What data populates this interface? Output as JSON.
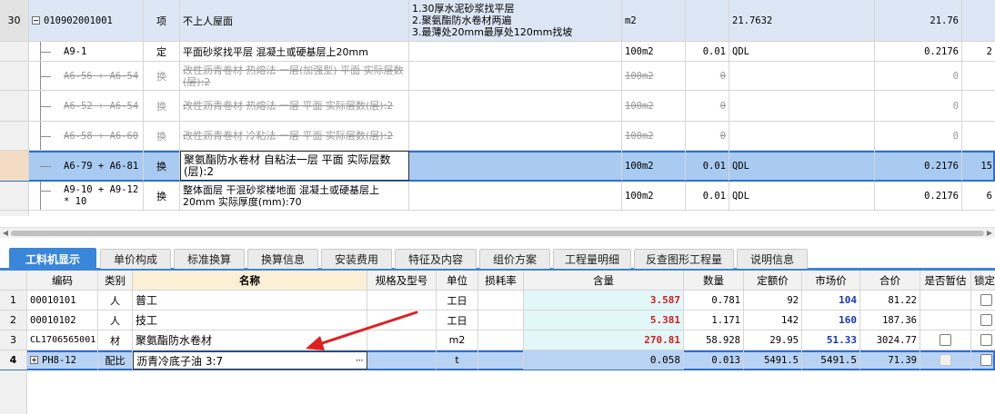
{
  "top_rows": [
    {
      "idx": "30",
      "code": "010902001001",
      "type": "项",
      "name": "不上人屋面",
      "features": [
        "1.30厚水泥砂浆找平层",
        "2.聚氨酯防水卷材两遍",
        "3.最薄处20mm最厚处120mm找坡"
      ],
      "unit": "m2",
      "qty": "",
      "expr": "21.7632",
      "qty2": "21.76",
      "rest": ""
    },
    {
      "idx": "",
      "code": "A9-1",
      "type": "定",
      "name": "平面砂浆找平层 混凝土或硬基层上20mm",
      "unit": "100m2",
      "qty": "0.01",
      "expr": "QDL",
      "qty2": "0.2176",
      "rest": "2"
    },
    {
      "idx": "",
      "code": "A6-56 + A6-54",
      "type": "换",
      "name": "改性沥青卷材 热熔法 一层(加强型) 平面 实际层数(层):2",
      "unit": "100m2",
      "qty": "0",
      "expr": "",
      "qty2": "0",
      "rest": ""
    },
    {
      "idx": "",
      "code": "A6-52 + A6-54",
      "type": "换",
      "name": "改性沥青卷材 热熔法 一层 平面 实际层数(层):2",
      "unit": "100m2",
      "qty": "0",
      "expr": "",
      "qty2": "0",
      "rest": ""
    },
    {
      "idx": "",
      "code": "A6-58 + A6-60",
      "type": "换",
      "name": "改性沥青卷材 冷粘法 一层 平面 实际层数(层):2",
      "unit": "100m2",
      "qty": "0",
      "expr": "",
      "qty2": "0",
      "rest": ""
    },
    {
      "idx": "",
      "code": "A6-79 + A6-81",
      "type": "换",
      "name": "聚氨酯防水卷材 自粘法一层 平面  实际层数(层):2",
      "unit": "100m2",
      "qty": "0.01",
      "expr": "QDL",
      "qty2": "0.2176",
      "rest": "15"
    },
    {
      "idx": "",
      "code": "A9-10 + A9-12 * 10",
      "type": "换",
      "name": "整体面层 干混砂浆楼地面 混凝土或硬基层上20mm  实际厚度(mm):70",
      "unit": "100m2",
      "qty": "0.01",
      "expr": "QDL",
      "qty2": "0.2176",
      "rest": "6"
    }
  ],
  "tabs": [
    "工料机显示",
    "单价构成",
    "标准换算",
    "换算信息",
    "安装费用",
    "特征及内容",
    "组价方案",
    "工程量明细",
    "反查图形工程量",
    "说明信息"
  ],
  "bottom_headers": {
    "idx": "",
    "code": "编码",
    "cat": "类别",
    "name": "名称",
    "spec": "规格及型号",
    "unit": "单位",
    "loss": "损耗率",
    "content": "含量",
    "count": "数量",
    "quota": "定额价",
    "market": "市场价",
    "total": "合价",
    "est": "是否暂估",
    "lock": "锁定"
  },
  "bottom_rows": [
    {
      "idx": "1",
      "code": "00010101",
      "cat": "人",
      "name": "普工",
      "unit": "工日",
      "content": "3.587",
      "count": "0.781",
      "quota": "92",
      "market": "104",
      "total": "81.22"
    },
    {
      "idx": "2",
      "code": "00010102",
      "cat": "人",
      "name": "技工",
      "unit": "工日",
      "content": "5.381",
      "count": "1.171",
      "quota": "142",
      "market": "160",
      "total": "187.36"
    },
    {
      "idx": "3",
      "code": "CL1706565001",
      "cat": "材",
      "name": "聚氨酯防水卷材",
      "unit": "m2",
      "content": "270.81",
      "count": "58.928",
      "quota": "29.95",
      "market": "51.33",
      "total": "3024.77"
    },
    {
      "idx": "4",
      "code": "PH8-12",
      "cat": "配比",
      "name": "沥青冷底子油 3:7",
      "unit": "t",
      "content": "0.058",
      "count": "0.013",
      "quota": "5491.5",
      "market": "5491.5",
      "total": "71.39"
    }
  ],
  "ellipsis_label": "···",
  "colors": {
    "tab_active": "#3a86d8",
    "selection": "#a9cbf2",
    "content_red": "#d41c1c",
    "market_blue": "#1336b8",
    "annotation_arrow": "#e02020"
  }
}
